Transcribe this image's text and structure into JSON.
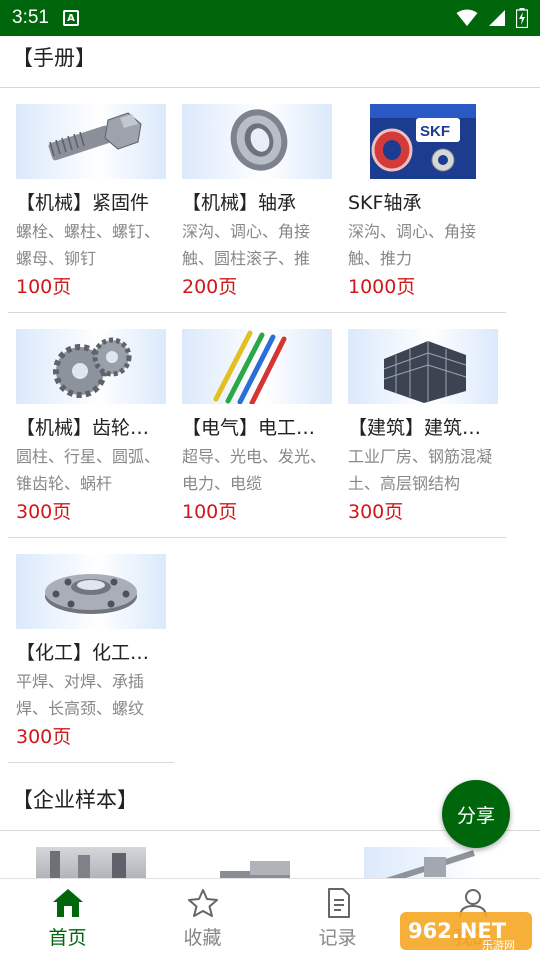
{
  "status_bar": {
    "time": "3:51",
    "badge": "A"
  },
  "sections": {
    "manual": {
      "title": "【手册】"
    },
    "enterprise": {
      "title": "【企业样本】"
    }
  },
  "cards": [
    {
      "title": "【机械】紧固件",
      "desc": "螺栓、螺柱、螺钉、螺母、铆钉",
      "pages": "100页",
      "icon": "bolt-image"
    },
    {
      "title": "【机械】轴承",
      "desc": "深沟、调心、角接触、圆柱滚子、推",
      "pages": "200页",
      "icon": "bearing-image"
    },
    {
      "title": "SKF轴承",
      "desc": "深沟、调心、角接触、推力",
      "pages": "1000页",
      "icon": "skf-bearing-image"
    },
    {
      "title": "【机械】齿轮…",
      "desc": "圆柱、行星、圆弧、锥齿轮、蜗杆",
      "pages": "300页",
      "icon": "gear-image"
    },
    {
      "title": "【电气】电工…",
      "desc": "超导、光电、发光、电力、电缆",
      "pages": "100页",
      "icon": "cable-image"
    },
    {
      "title": "【建筑】建筑…",
      "desc": "工业厂房、钢筋混凝土、高层钢结构",
      "pages": "300页",
      "icon": "building-frame-image"
    },
    {
      "title": "【化工】化工…",
      "desc": "平焊、对焊、承插焊、长高颈、螺纹",
      "pages": "300页",
      "icon": "flange-image"
    }
  ],
  "fab": {
    "label": "分享"
  },
  "bottom_nav": {
    "items": [
      {
        "label": "首页",
        "icon": "home-icon",
        "active": true
      },
      {
        "label": "收藏",
        "icon": "star-icon",
        "active": false
      },
      {
        "label": "记录",
        "icon": "document-icon",
        "active": false
      },
      {
        "label": "我的",
        "icon": "person-icon",
        "active": false
      }
    ]
  },
  "watermark": {
    "text": "962.NET",
    "subtext": "乐游网"
  },
  "colors": {
    "brand": "#00660c",
    "price": "#d01818",
    "muted": "#888888"
  }
}
